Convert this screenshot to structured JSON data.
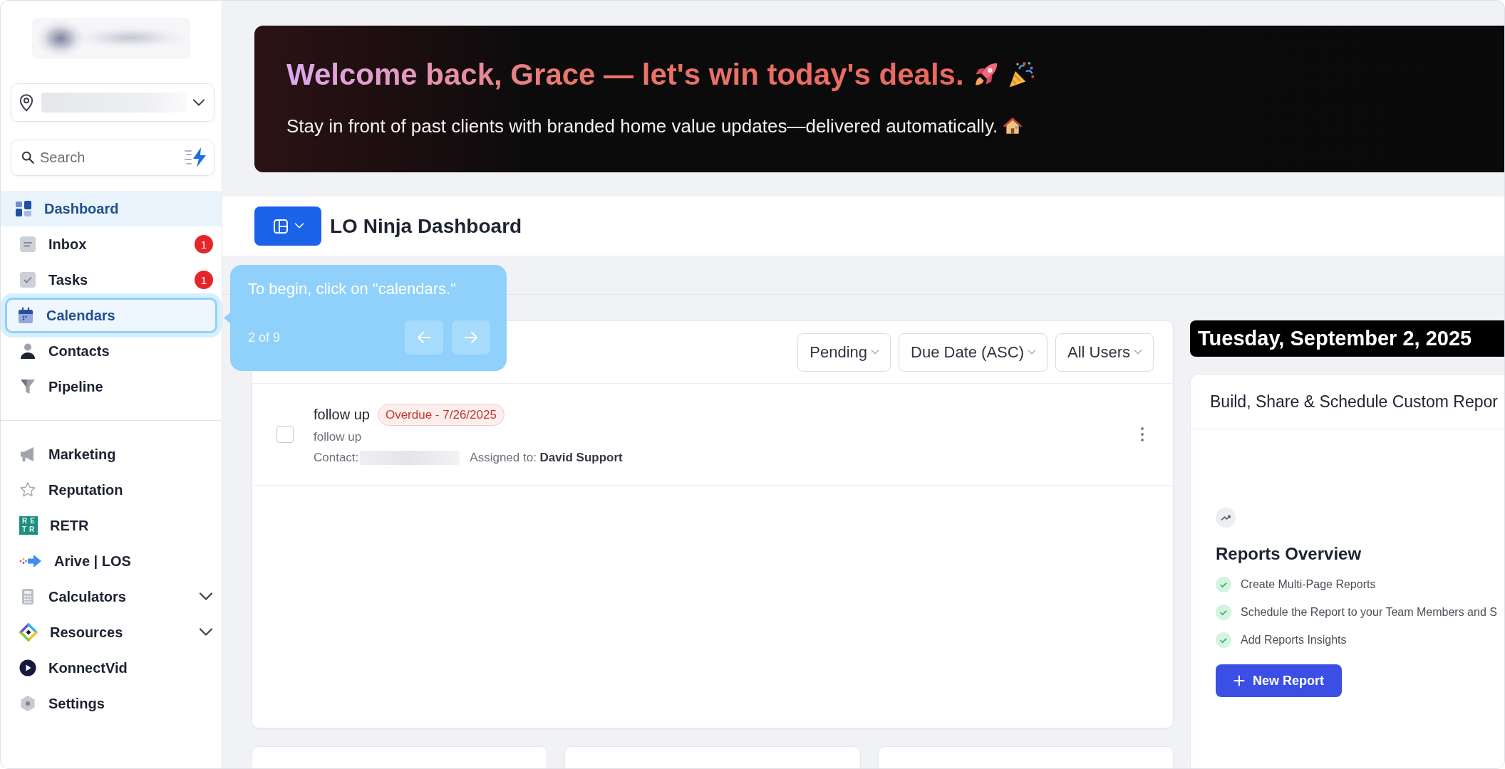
{
  "sidebar": {
    "search": {
      "placeholder": "Search"
    },
    "nav_primary": [
      {
        "label": "Dashboard",
        "selected": true,
        "highlighted": false
      },
      {
        "label": "Inbox",
        "selected": false,
        "highlighted": false,
        "badge": "1"
      },
      {
        "label": "Tasks",
        "selected": false,
        "highlighted": false,
        "badge": "1"
      },
      {
        "label": "Calendars",
        "selected": false,
        "highlighted": true
      },
      {
        "label": "Contacts",
        "selected": false,
        "highlighted": false
      },
      {
        "label": "Pipeline",
        "selected": false,
        "highlighted": false
      }
    ],
    "nav_secondary": [
      {
        "label": "Marketing",
        "selected": false,
        "highlighted": false
      },
      {
        "label": "Reputation",
        "selected": false,
        "highlighted": false
      },
      {
        "label": "RETR",
        "selected": false,
        "highlighted": false,
        "logo_rows": [
          "RE",
          "TR"
        ]
      },
      {
        "label": "Arive | LOS",
        "selected": false,
        "highlighted": false
      },
      {
        "label": "Calculators",
        "selected": false,
        "highlighted": false,
        "expanded": false
      },
      {
        "label": "Resources",
        "selected": false,
        "highlighted": false,
        "expanded": false
      },
      {
        "label": "KonnectVid",
        "selected": false,
        "highlighted": false
      },
      {
        "label": "Settings",
        "selected": false,
        "highlighted": false
      }
    ]
  },
  "banner": {
    "title": "Welcome back, Grace — let's win today's deals.",
    "subtitle": "Stay in front of past clients with branded home value updates—delivered automatically."
  },
  "dashboard_header": {
    "title": "LO Ninja Dashboard"
  },
  "tasks_card": {
    "filters": [
      {
        "label": "Pending"
      },
      {
        "label": "Due Date (ASC)"
      },
      {
        "label": "All Users"
      }
    ],
    "tasks": [
      {
        "title": "follow up",
        "status": "Overdue - 7/26/2025",
        "description": "follow up",
        "contact_label": "Contact:",
        "assignment": "Assigned to: **David Support**",
        "checked": false
      }
    ]
  },
  "date_banner": {
    "text": "Tuesday, September 2, 2025"
  },
  "reports_card": {
    "header": "Build, Share & Schedule Custom Repor",
    "title": "Reports Overview",
    "features": [
      "Create Multi-Page Reports",
      "Schedule the Report to your Team Members and S",
      "Add Reports Insights"
    ],
    "button": "New Report"
  },
  "tour_tooltip": {
    "text": "To begin, click on \"calendars.\"",
    "step": "2 of 9"
  }
}
